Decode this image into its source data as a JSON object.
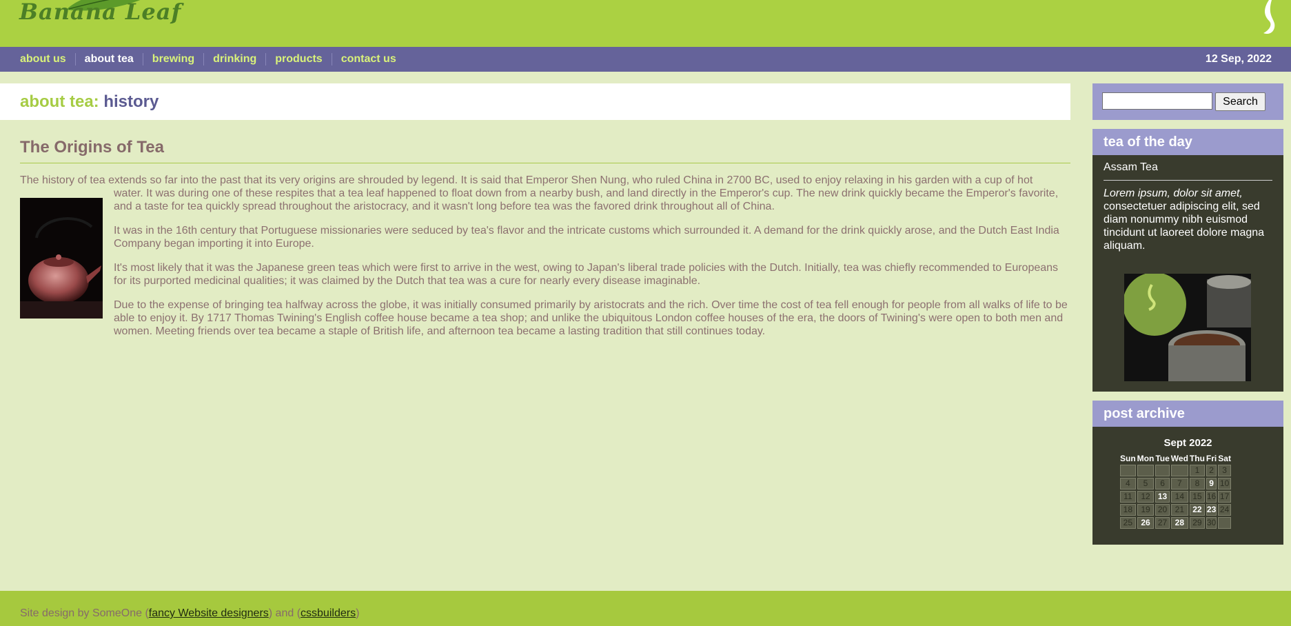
{
  "site": {
    "logo_text": "Banana Leaf"
  },
  "nav": {
    "items": [
      {
        "label": "about us",
        "active": false
      },
      {
        "label": "about tea",
        "active": true
      },
      {
        "label": "brewing",
        "active": false
      },
      {
        "label": "drinking",
        "active": false
      },
      {
        "label": "products",
        "active": false
      },
      {
        "label": "contact us",
        "active": false
      }
    ],
    "date": "12 Sep, 2022"
  },
  "page_heading": {
    "section": "about tea:",
    "page": "history"
  },
  "article": {
    "title": "The Origins of Tea",
    "image_icon": "teapot-photo",
    "paragraphs": [
      "The history of tea extends so far into the past that its very origins are shrouded by legend. It is said that Emperor Shen Nung, who ruled China in 2700 BC, used to enjoy relaxing in his garden with a cup of hot",
      "water. It was during one of these respites that a tea leaf happened to float down from a nearby bush, and land directly in the Emperor's cup. The new drink quickly became the Emperor's favorite, and a taste for tea quickly spread throughout the aristocracy, and it wasn't long before tea was the favored drink throughout all of China.",
      "It was in the 16th century that Portuguese missionaries were seduced by tea's flavor and the intricate customs which surrounded it. A demand for the drink quickly arose, and the Dutch East India Company began importing it into Europe.",
      "It's most likely that it was the Japanese green teas which were first to arrive in the west, owing to Japan's liberal trade policies with the Dutch. Initially, tea was chiefly recommended to Europeans for its purported medicinal qualities; it was claimed by the Dutch that tea was a cure for nearly every disease imaginable.",
      "Due to the expense of bringing tea halfway across the globe, it was initially consumed primarily by aristocrats and the rich. Over time the cost of tea fell enough for people from all walks of life to be able to enjoy it. By 1717 Thomas Twining's English coffee house became a tea shop; and unlike the ubiquitous London coffee houses of the era, the doors of Twining's were open to both men and women. Meeting friends over tea became a staple of British life, and afternoon tea became a lasting tradition that still continues today."
    ]
  },
  "search": {
    "value": "",
    "placeholder": "",
    "button_label": "Search"
  },
  "tea_of_the_day": {
    "title": "tea of the day",
    "name": "Assam Tea",
    "description_italic": "Lorem ipsum, dolor sit amet,",
    "description_rest": " consectetuer adipiscing elit, sed diam nonummy nibh euismod tincidunt ut laoreet dolore magna aliquam.",
    "image_icon": "tea-tin-photo"
  },
  "post_archive": {
    "title": "post archive",
    "calendar": {
      "month": "Sept 2022",
      "weekdays": [
        "Sun",
        "Mon",
        "Tue",
        "Wed",
        "Thu",
        "Fri",
        "Sat"
      ],
      "weeks": [
        [
          "",
          "",
          "",
          "",
          "1",
          "2",
          "3"
        ],
        [
          "4",
          "5",
          "6",
          "7",
          "8",
          "9",
          "10"
        ],
        [
          "11",
          "12",
          "13",
          "14",
          "15",
          "16",
          "17"
        ],
        [
          "18",
          "19",
          "20",
          "21",
          "22",
          "23",
          "24"
        ],
        [
          "25",
          "26",
          "27",
          "28",
          "29",
          "30",
          ""
        ]
      ],
      "linked_days": [
        "9",
        "13",
        "22",
        "23",
        "26",
        "28"
      ]
    }
  },
  "footer": {
    "prefix": "Site design by SomeOne (",
    "link1": "fancy Website designers",
    "middle": ") and (",
    "link2": "cssbuilders",
    "suffix": ")"
  },
  "colors": {
    "header_green": "#abd142",
    "nav_purple": "#65639a",
    "page_bg": "#e2ecc4",
    "widget_head": "#9b9bcd",
    "widget_body": "#393b2d",
    "text_brown": "#8c7070"
  }
}
